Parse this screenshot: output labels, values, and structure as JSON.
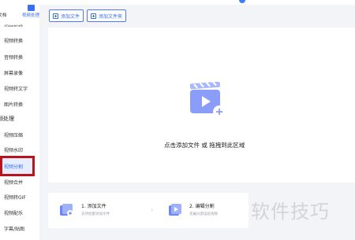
{
  "sidebar": {
    "tabs": [
      {
        "label": "文档",
        "active": false
      },
      {
        "label": "视频处理",
        "active": true
      }
    ],
    "cut_item": "视频剪辑",
    "items": [
      {
        "label": "视频转换"
      },
      {
        "label": "音频转换"
      },
      {
        "label": "屏幕录像"
      },
      {
        "label": "视频转文字"
      },
      {
        "label": "图片转换"
      }
    ],
    "group_label": "频处理",
    "group_items": [
      {
        "label": "视频压缩"
      },
      {
        "label": "视频水印"
      },
      {
        "label": "视频分割",
        "active": true
      },
      {
        "label": "视频合并"
      },
      {
        "label": "视频转GIF"
      },
      {
        "label": "视频配乐"
      },
      {
        "label": "字幕/贴图"
      }
    ]
  },
  "toolbar": {
    "add_file": "添加文件",
    "add_folder": "添加文件夹"
  },
  "dropzone": {
    "text": "点击添加文件 或 拖拽到此区域",
    "icon": "video-clapper-add-icon"
  },
  "steps": [
    {
      "title": "1. 添加文件",
      "sub": "支持批量添加文件",
      "icon": "add-file-icon"
    },
    {
      "title": "2. 编辑分割",
      "sub": "先编分割设段视频",
      "icon": "edit-split-icon"
    }
  ],
  "watermark": "软件技巧",
  "colors": {
    "accent": "#3a6df0",
    "highlight_border": "#b8141c",
    "icon_purple": "#8a9df8"
  }
}
